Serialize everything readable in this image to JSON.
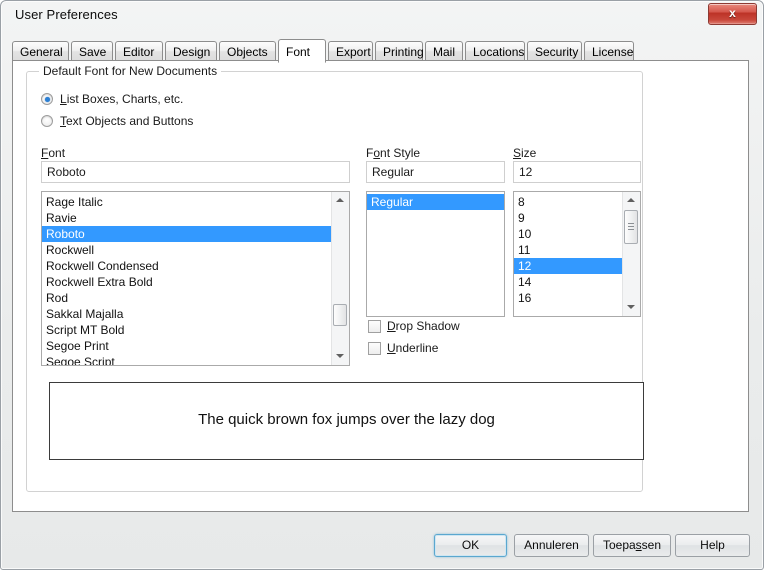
{
  "window": {
    "title": "User Preferences",
    "close_label": "x"
  },
  "tabs": [
    {
      "label": "General",
      "active": false
    },
    {
      "label": "Save",
      "active": false
    },
    {
      "label": "Editor",
      "active": false
    },
    {
      "label": "Design",
      "active": false
    },
    {
      "label": "Objects",
      "active": false
    },
    {
      "label": "Font",
      "active": true
    },
    {
      "label": "Export",
      "active": false
    },
    {
      "label": "Printing",
      "active": false
    },
    {
      "label": "Mail",
      "active": false
    },
    {
      "label": "Locations",
      "active": false
    },
    {
      "label": "Security",
      "active": false
    },
    {
      "label": "License",
      "active": false
    }
  ],
  "groupbox": {
    "label": "Default Font for New Documents"
  },
  "radios": [
    {
      "label": "List Boxes, Charts, etc.",
      "accel": "L",
      "checked": true
    },
    {
      "label": "Text Objects and Buttons",
      "accel": "T",
      "checked": false
    }
  ],
  "font": {
    "label": "Font",
    "accel": "F",
    "value": "Roboto",
    "items": [
      "Rage Italic",
      "Ravie",
      "Roboto",
      "Rockwell",
      "Rockwell Condensed",
      "Rockwell Extra Bold",
      "Rod",
      "Sakkal Majalla",
      "Script MT Bold",
      "Segoe Print",
      "Segoe Script"
    ],
    "selected": "Roboto"
  },
  "font_style": {
    "label": "Font Style",
    "accel": "o",
    "value": "Regular",
    "items": [
      "Regular"
    ],
    "selected": "Regular"
  },
  "size": {
    "label": "Size",
    "accel": "S",
    "value": "12",
    "items": [
      "8",
      "9",
      "10",
      "11",
      "12",
      "14",
      "16"
    ],
    "selected": "12"
  },
  "checkboxes": [
    {
      "label": "Drop Shadow",
      "accel": "D",
      "checked": false
    },
    {
      "label": "Underline",
      "accel": "U",
      "checked": false
    }
  ],
  "preview": {
    "text": "The quick brown fox jumps over the lazy dog"
  },
  "footer": {
    "ok": "OK",
    "cancel": "Annuleren",
    "apply": "Toepassen",
    "help": "Help"
  },
  "colors": {
    "selection_blue": "#3399ff",
    "close_red": "#c9483b",
    "focus_blue": "#5ba7cf",
    "window_bg": "#eaecec",
    "panel_bg": "#ffffff"
  }
}
